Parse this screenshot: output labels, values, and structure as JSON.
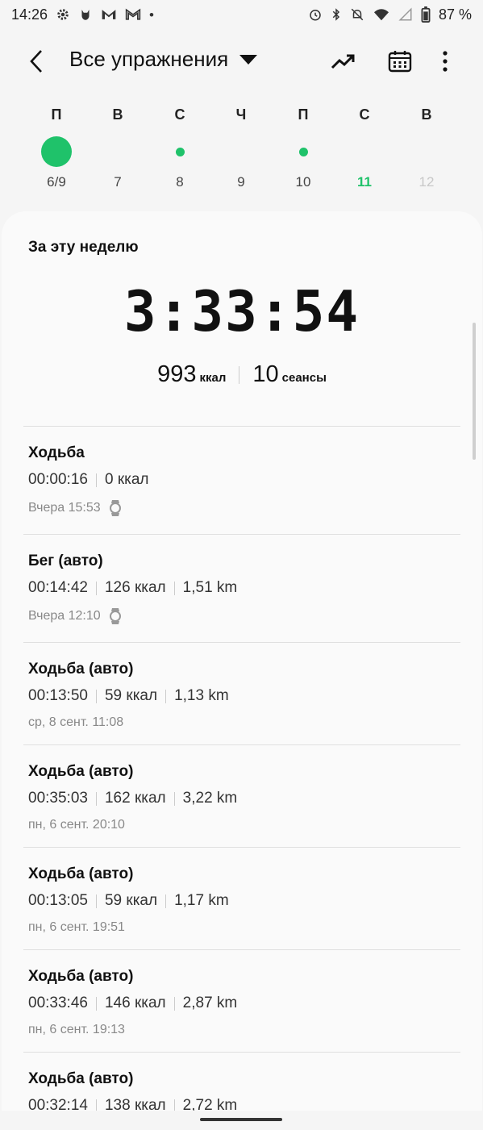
{
  "statusbar": {
    "time": "14:26",
    "left_icons": [
      "settings-icon",
      "cat-icon",
      "gmail-icon",
      "gmail-icon",
      "dot-icon"
    ],
    "right_icons": [
      "alarm-icon",
      "bluetooth-icon",
      "mute-icon",
      "wifi-icon",
      "signal-icon",
      "battery-icon"
    ],
    "battery": "87 %"
  },
  "appbar": {
    "title": "Все упражнения",
    "actions": [
      "trend-icon",
      "calendar-icon",
      "more-vert-icon"
    ]
  },
  "week": {
    "days": [
      {
        "letter": "П",
        "num": "6/9",
        "mark": "big"
      },
      {
        "letter": "В",
        "num": "7",
        "mark": "none"
      },
      {
        "letter": "С",
        "num": "8",
        "mark": "small"
      },
      {
        "letter": "Ч",
        "num": "9",
        "mark": "none"
      },
      {
        "letter": "П",
        "num": "10",
        "mark": "small"
      },
      {
        "letter": "С",
        "num": "11",
        "mark": "none",
        "today": true
      },
      {
        "letter": "В",
        "num": "12",
        "mark": "none",
        "future": true
      }
    ],
    "accent": "#1fc26a"
  },
  "summary": {
    "heading": "За эту неделю",
    "duration": "3:33:54",
    "calories": "993",
    "calories_unit": "ккал",
    "sessions": "10",
    "sessions_unit": "сеансы"
  },
  "workouts": [
    {
      "title": "Ходьба",
      "duration": "00:00:16",
      "calories": "0 ккал",
      "distance": "",
      "when": "Вчера 15:53",
      "watch": true
    },
    {
      "title": "Бег (авто)",
      "duration": "00:14:42",
      "calories": "126 ккал",
      "distance": "1,51 km",
      "when": "Вчера 12:10",
      "watch": true
    },
    {
      "title": "Ходьба (авто)",
      "duration": "00:13:50",
      "calories": "59 ккал",
      "distance": "1,13 km",
      "when": "ср, 8 сент. 11:08",
      "watch": false
    },
    {
      "title": "Ходьба (авто)",
      "duration": "00:35:03",
      "calories": "162 ккал",
      "distance": "3,22 km",
      "when": "пн, 6 сент. 20:10",
      "watch": false
    },
    {
      "title": "Ходьба (авто)",
      "duration": "00:13:05",
      "calories": "59 ккал",
      "distance": "1,17 km",
      "when": "пн, 6 сент. 19:51",
      "watch": false
    },
    {
      "title": "Ходьба (авто)",
      "duration": "00:33:46",
      "calories": "146 ккал",
      "distance": "2,87 km",
      "when": "пн, 6 сент. 19:13",
      "watch": false
    },
    {
      "title": "Ходьба (авто)",
      "duration": "00:32:14",
      "calories": "138 ккал",
      "distance": "2,72 km",
      "when": "",
      "watch": false
    }
  ]
}
